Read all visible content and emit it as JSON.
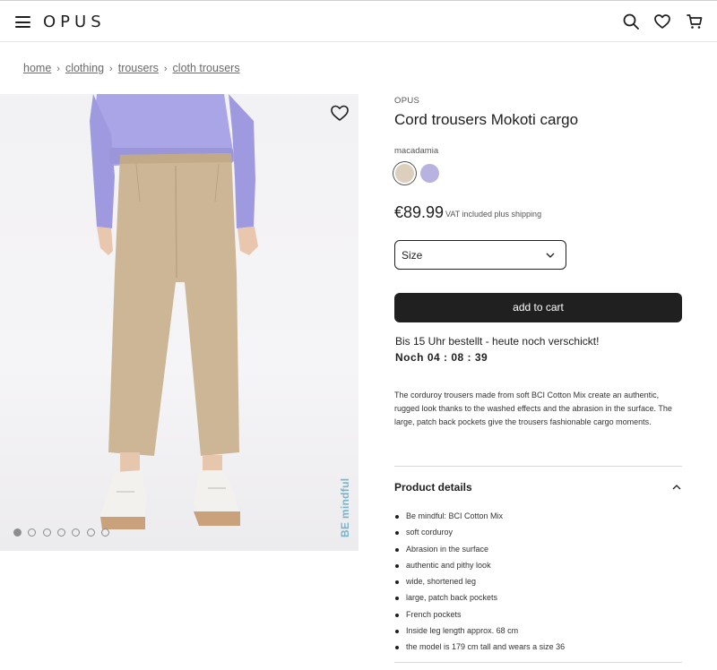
{
  "header": {
    "logo": "OPUS",
    "icons": [
      "menu-icon",
      "search-icon",
      "heart-icon",
      "cart-icon"
    ]
  },
  "breadcrumb": {
    "items": [
      "home",
      "clothing",
      "trousers",
      "cloth trousers"
    ],
    "separator": "›"
  },
  "gallery": {
    "badge": "BE mindful",
    "dot_count": 7,
    "active_dot": 1,
    "badge_color": "#7bb3c9"
  },
  "product": {
    "brand": "OPUS",
    "title": "Cord trousers Mokoti cargo",
    "color_name": "macadamia",
    "swatches": [
      {
        "name": "macadamia",
        "color": "#dccfbc",
        "selected": true
      },
      {
        "name": "lavender",
        "color": "#b8b2e0",
        "selected": false
      }
    ],
    "price": "€89.99",
    "price_note": "VAT included plus shipping",
    "size_placeholder": "Size",
    "add_to_cart": "add to cart",
    "shipping_note": "Bis 15 Uhr bestellt - heute noch verschickt!",
    "countdown": "Noch 04 : 08 : 39",
    "description": "The corduroy trousers made from soft BCI Cotton Mix create an authentic, rugged look thanks to the washed effects and the abrasion in the surface. The large, patch back pockets give the trousers fashionable cargo moments.",
    "details_heading": "Product details",
    "details": [
      "Be mindful: BCI Cotton Mix",
      "soft corduroy",
      "Abrasion in the surface",
      "authentic and pithy look",
      "wide, shortened leg",
      "large, patch back pockets",
      "French pockets",
      "Inside leg length approx. 68 cm",
      "the model is 179 cm tall and wears a size 36"
    ]
  }
}
